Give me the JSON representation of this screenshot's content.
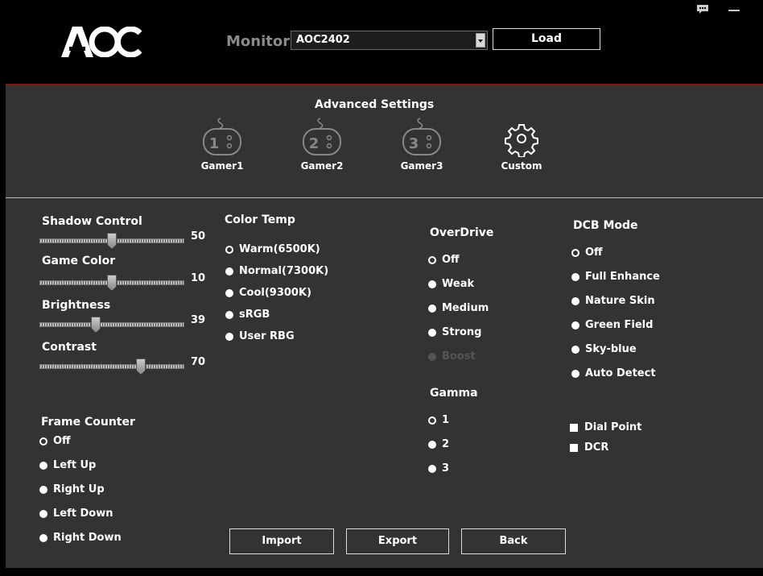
{
  "header": {
    "logo_text": "AOC",
    "monitor_label": "Monitor",
    "monitor_value": "AOC2402",
    "load_label": "Load"
  },
  "advanced": {
    "title": "Advanced Settings",
    "modes": [
      {
        "label": "Gamer1",
        "num": "1"
      },
      {
        "label": "Gamer2",
        "num": "2"
      },
      {
        "label": "Gamer3",
        "num": "3"
      },
      {
        "label": "Custom"
      }
    ]
  },
  "sliders": [
    {
      "label": "Shadow Control",
      "value": "50",
      "fraction": 0.5
    },
    {
      "label": "Game Color",
      "value": "10",
      "fraction": 0.5
    },
    {
      "label": "Brightness",
      "value": "39",
      "fraction": 0.39
    },
    {
      "label": "Contrast",
      "value": "70",
      "fraction": 0.7
    }
  ],
  "frame_counter": {
    "title": "Frame Counter",
    "options": [
      "Off",
      "Left Up",
      "Right Up",
      "Left Down",
      "Right Down"
    ],
    "selected": "Off"
  },
  "color_temp": {
    "title": "Color Temp",
    "options": [
      "Warm(6500K)",
      "Normal(7300K)",
      "Cool(9300K)",
      "sRGB",
      "User RBG"
    ],
    "selected": "Warm(6500K)"
  },
  "overdrive": {
    "title": "OverDrive",
    "options": [
      "Off",
      "Weak",
      "Medium",
      "Strong",
      "Boost"
    ],
    "selected": "Off",
    "disabled": "Boost"
  },
  "gamma": {
    "title": "Gamma",
    "options": [
      "1",
      "2",
      "3"
    ],
    "selected": "1"
  },
  "dcb_mode": {
    "title": "DCB Mode",
    "options": [
      "Off",
      "Full Enhance",
      "Nature Skin",
      "Green Field",
      "Sky-blue",
      "Auto Detect"
    ],
    "selected": "Off"
  },
  "checks": {
    "dial_point": "Dial Point",
    "dcr": "DCR"
  },
  "buttons": {
    "import": "Import",
    "export": "Export",
    "back": "Back"
  }
}
